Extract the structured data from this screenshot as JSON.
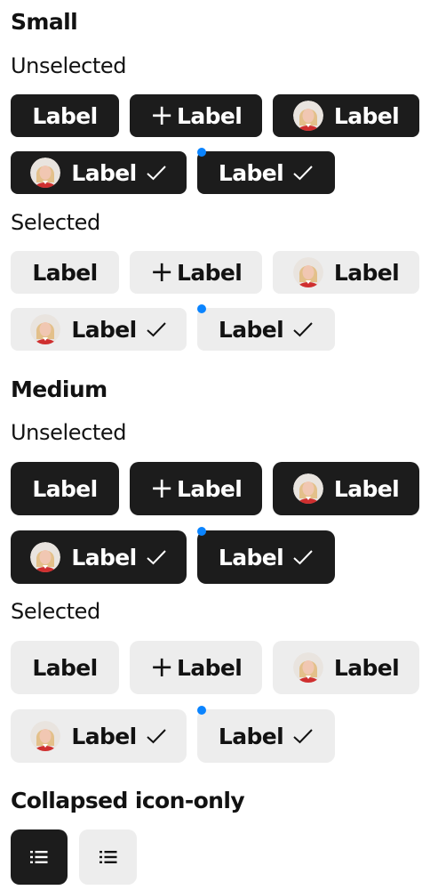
{
  "chip_label": "Label",
  "sections": {
    "small": "Small",
    "medium": "Medium",
    "collapsed": "Collapsed icon-only"
  },
  "states": {
    "unselected": "Unselected",
    "selected": "Selected"
  },
  "colors": {
    "chip_dark": "#1c1c1c",
    "chip_light": "#ededed",
    "text_dark": "#121212",
    "badge_dot": "#0a84ff"
  },
  "icons": {
    "add": "plus-icon",
    "selected": "checkmark-icon",
    "avatar": "person-avatar",
    "collapsed": "list-icon"
  }
}
